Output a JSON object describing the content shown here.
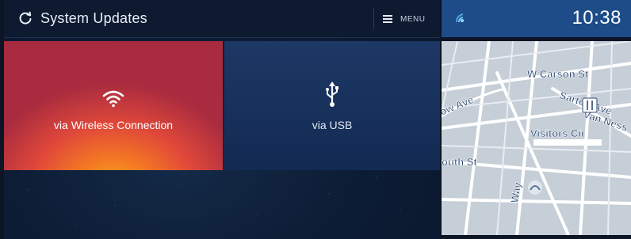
{
  "header": {
    "title": "System Updates",
    "menu_label": "MENU"
  },
  "tiles": [
    {
      "label": "via Wireless Connection",
      "icon": "wifi-icon"
    },
    {
      "label": "via USB",
      "icon": "usb-icon"
    }
  ],
  "status": {
    "time": "10:38"
  },
  "map": {
    "streets": [
      "W Carson St",
      "Sartori Ave",
      "Van Ness",
      "Visitors Cir",
      "ow Ave",
      "outh St",
      "Way"
    ],
    "poi_icon": "restaurant-icon"
  },
  "colors": {
    "accent_blue": "#1d4c88",
    "wifi_tile_orange": "#f47a22",
    "usb_tile_blue": "#17305a"
  }
}
